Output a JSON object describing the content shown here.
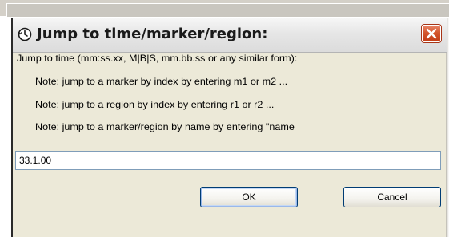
{
  "dialog": {
    "title": "Jump to time/marker/region:",
    "prompt": "Jump to time (mm:ss.xx, M|B|S, mm.bb.ss or any similar form):",
    "notes": [
      "Note: jump to a marker by index by entering m1 or m2 ...",
      "Note: jump to a region by index by entering r1 or r2 ...",
      "Note: jump to a marker/region by name by entering \"name"
    ],
    "time_value": "33.1.00",
    "ok_label": "OK",
    "cancel_label": "Cancel"
  },
  "colors": {
    "dialog_bg": "#ece9d8",
    "close_button": "#c23c16",
    "input_border": "#7f9db9",
    "button_border": "#003c74"
  },
  "icons": {
    "title": "history-clock-icon",
    "close": "close-x-icon"
  }
}
